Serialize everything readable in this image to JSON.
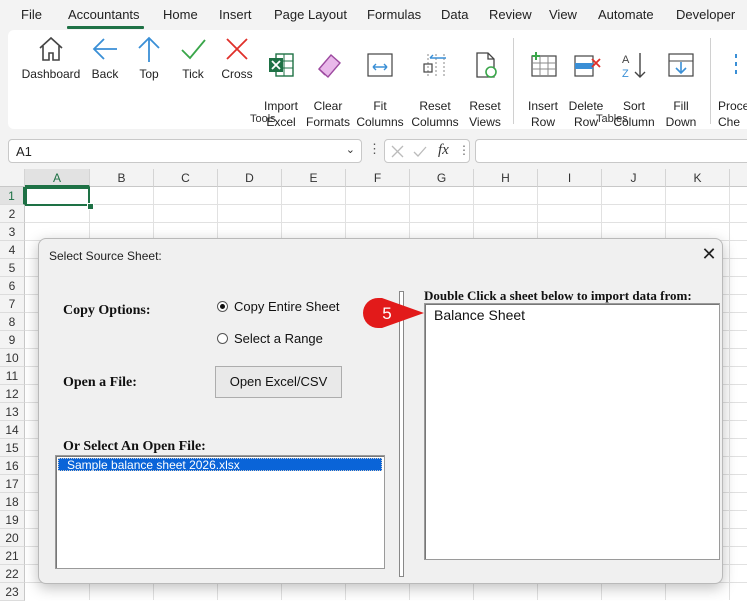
{
  "menu": [
    "File",
    "Accountants",
    "Home",
    "Insert",
    "Page Layout",
    "Formulas",
    "Data",
    "Review",
    "View",
    "Automate",
    "Developer"
  ],
  "ribbon": {
    "tools": [
      {
        "label": "Dashboard",
        "icon": "home-icon"
      },
      {
        "label": "Back",
        "icon": "arrow-left-icon"
      },
      {
        "label": "Top",
        "icon": "arrow-up-icon"
      },
      {
        "label": "Tick",
        "icon": "checkmark-icon"
      },
      {
        "label": "Cross",
        "icon": "cross-icon"
      },
      {
        "label": "Import\nExcel",
        "icon": "excel-icon"
      },
      {
        "label": "Clear\nFormats",
        "icon": "eraser-icon"
      },
      {
        "label": "Fit\nColumns",
        "icon": "fit-columns-icon"
      },
      {
        "label": "Reset\nColumns",
        "icon": "reset-columns-icon"
      },
      {
        "label": "Reset\nViews",
        "icon": "reset-views-icon"
      }
    ],
    "tables": [
      {
        "label": "Insert\nRow",
        "icon": "insert-row-icon"
      },
      {
        "label": "Delete\nRow",
        "icon": "delete-row-icon"
      },
      {
        "label": "Sort\nColumn",
        "icon": "sort-az-icon"
      },
      {
        "label": "Fill\nDown",
        "icon": "fill-down-icon"
      }
    ],
    "overflow_label": "Proce\nChe",
    "group_tools": "Tools",
    "group_tables": "Tables"
  },
  "formula_bar": {
    "name_box": "A1",
    "fx": "fx",
    "formula": ""
  },
  "grid": {
    "columns": [
      "A",
      "B",
      "C",
      "D",
      "E",
      "F",
      "G",
      "H",
      "I",
      "J",
      "K"
    ],
    "rows": [
      "1",
      "2",
      "3",
      "4",
      "5",
      "6",
      "7",
      "8",
      "9",
      "10",
      "11",
      "12",
      "13",
      "14",
      "15",
      "16",
      "17",
      "18",
      "19",
      "20",
      "21",
      "22",
      "23"
    ],
    "selected_cell": "A1"
  },
  "dialog": {
    "title": "Select Source Sheet:",
    "copy_options_label": "Copy Options:",
    "radio_entire": "Copy Entire Sheet",
    "radio_range": "Select a Range",
    "radio_selected": "entire",
    "open_file_label": "Open a File:",
    "open_button": "Open Excel/CSV",
    "open_files_label": "Or Select An Open File:",
    "open_files": [
      "Sample balance sheet 2026.xlsx"
    ],
    "sheets_label": "Double Click a sheet below to import data from:",
    "sheets": [
      "Balance Sheet"
    ]
  },
  "callout": {
    "number": "5",
    "color": "#e21a1a"
  }
}
